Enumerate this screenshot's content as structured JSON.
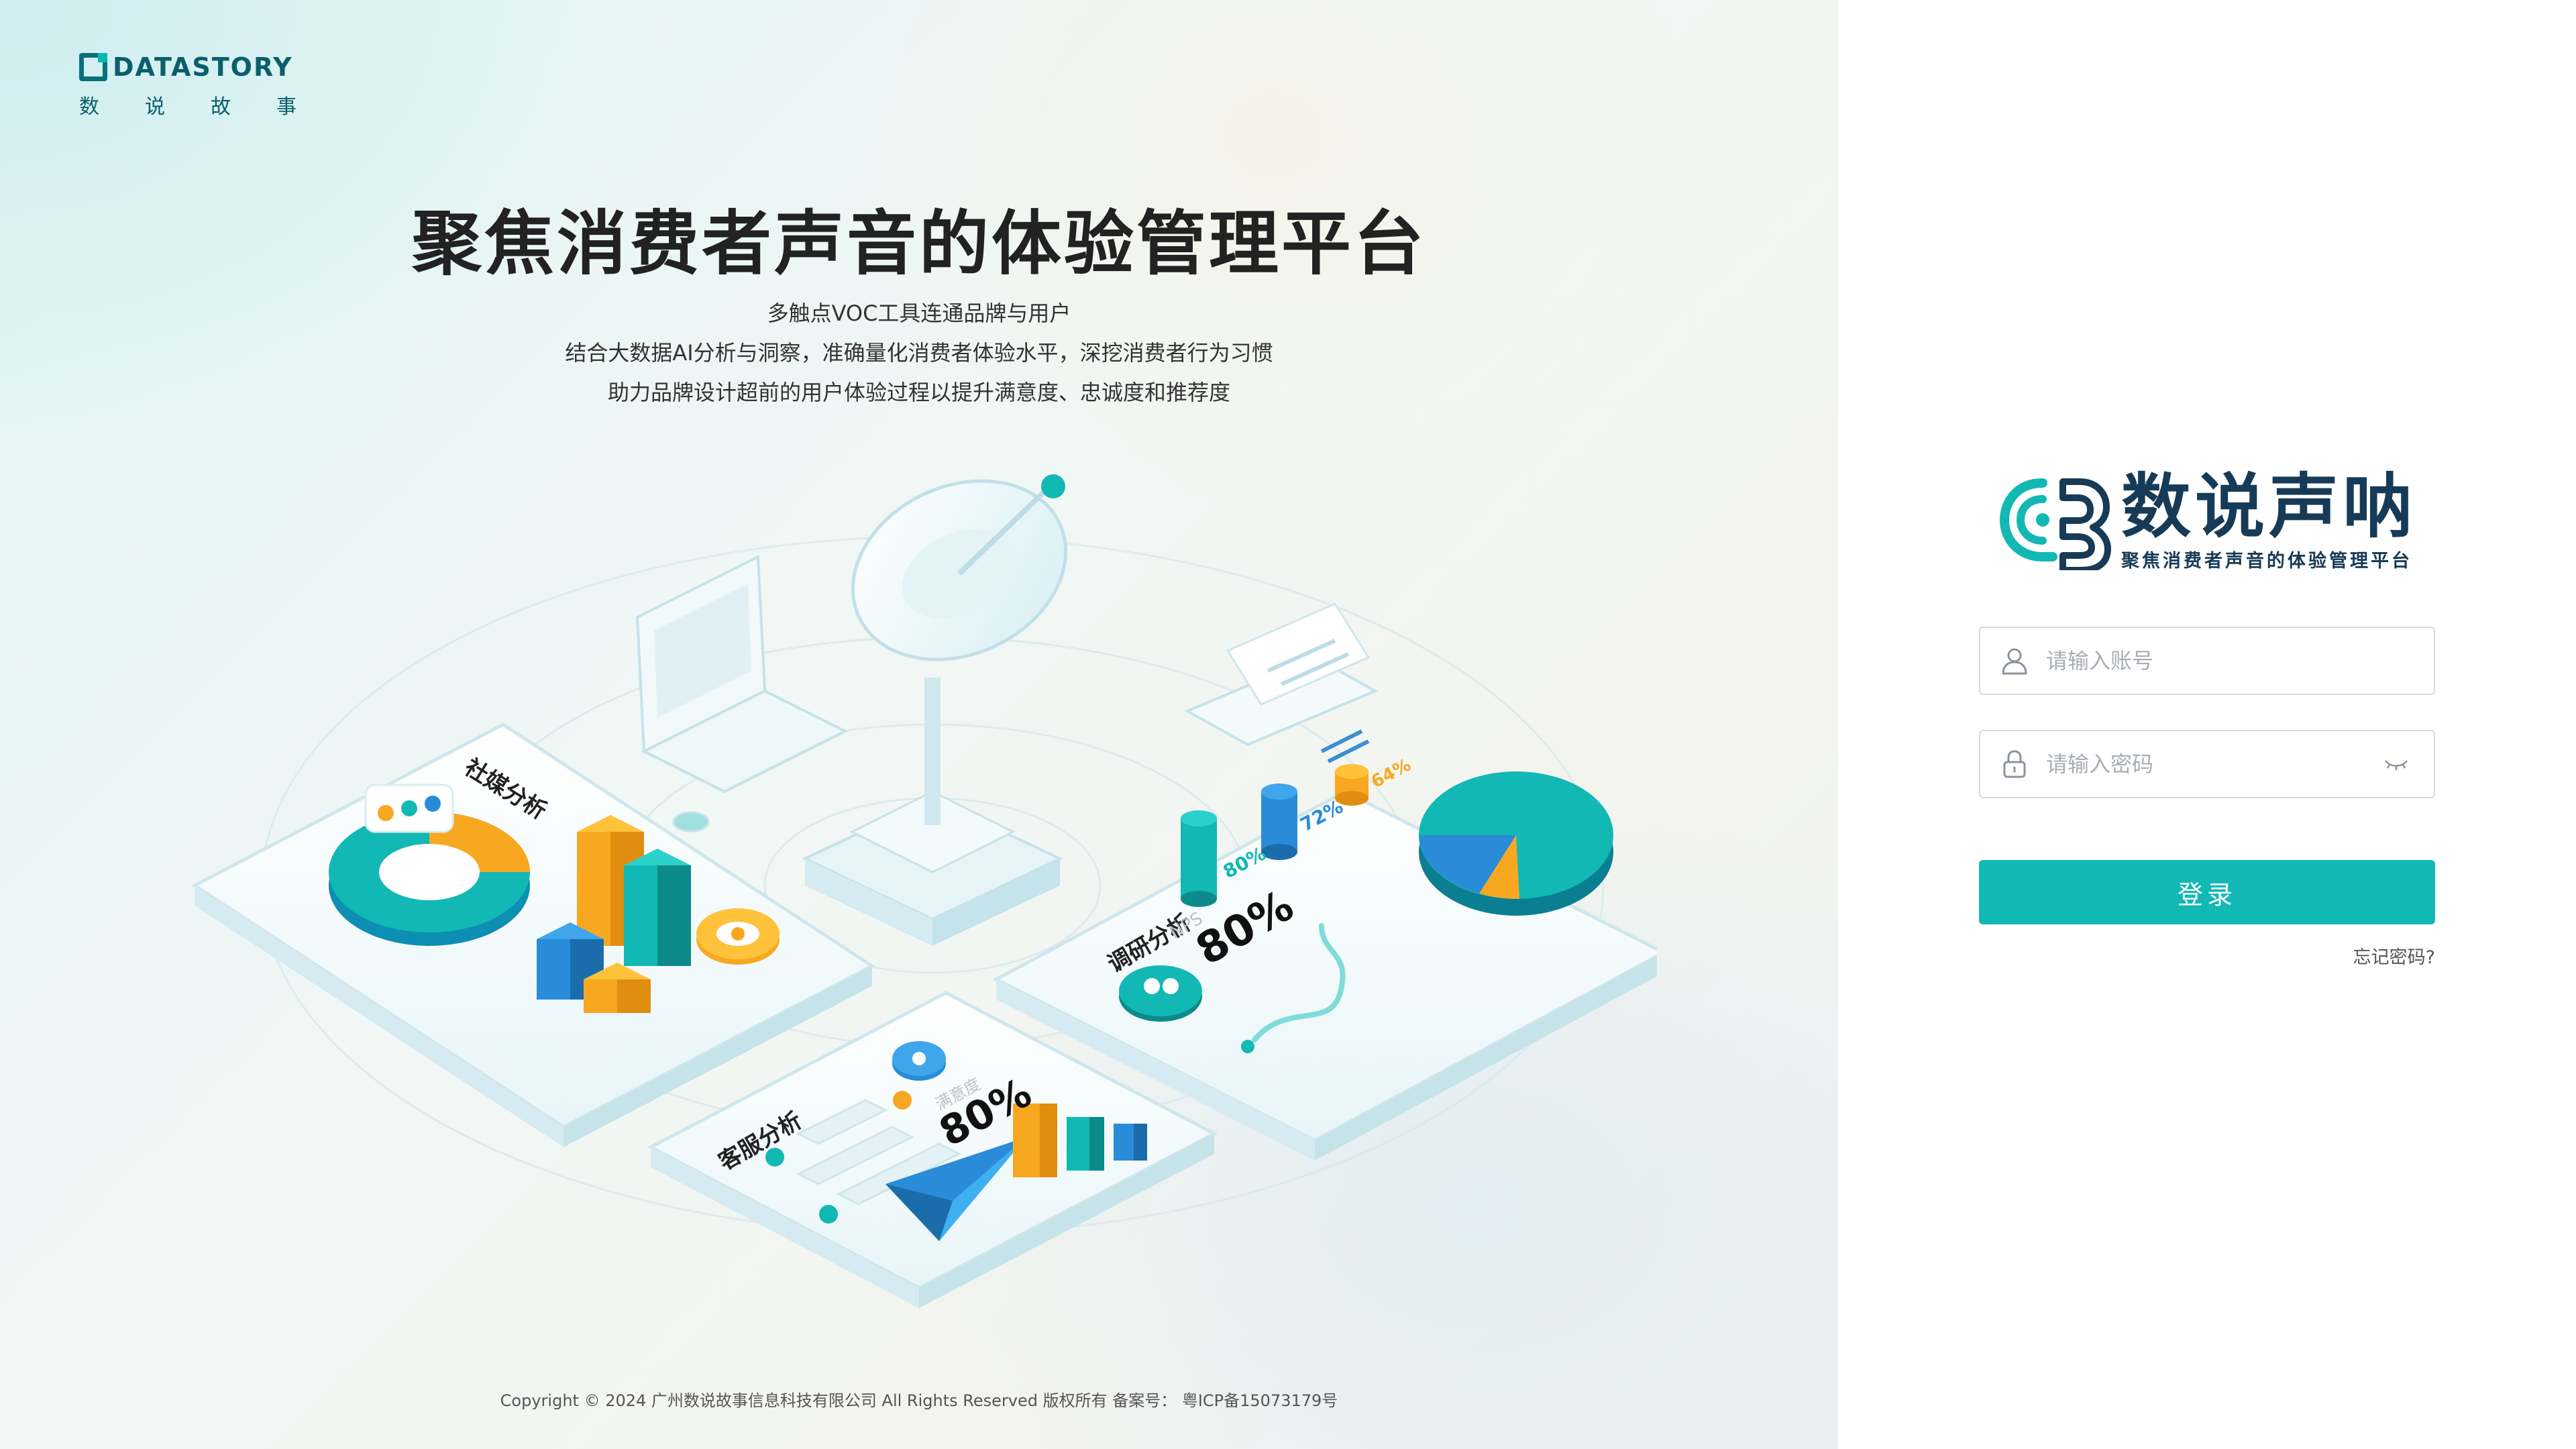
{
  "brand": {
    "name": "DATASTORY",
    "sub": [
      "数",
      "说",
      "故",
      "事"
    ]
  },
  "hero": {
    "title": "聚焦消费者声音的体验管理平台",
    "lines": [
      "多触点VOC工具连通品牌与用户",
      "结合大数据AI分析与洞察，准确量化消费者体验水平，深挖消费者行为习惯",
      "助力品牌设计超前的用户体验过程以提升满意度、忠诚度和推荐度"
    ]
  },
  "illustration": {
    "social_label": "社媒分析",
    "survey_label": "调研分析",
    "service_label": "客服分析",
    "nps_label": "NPS",
    "nps_value": "80%",
    "satisfaction_label": "满意度",
    "satisfaction_value": "80%",
    "pct_a": "80%",
    "pct_b": "72%",
    "pct_c": "64%"
  },
  "footer": {
    "copyright": "Copyright © 2024 广州数说故事信息科技有限公司 All Rights Reserved 版权所有 备案号： 粤ICP备15073179号"
  },
  "login": {
    "product_name": "数说声呐",
    "slogan": "聚焦消费者声音的体验管理平台",
    "account_placeholder": "请输入账号",
    "password_placeholder": "请输入密码",
    "login_label": "登录",
    "forgot_label": "忘记密码?"
  },
  "colors": {
    "accent": "#12b8b4",
    "brand_dark": "#0b5e6c",
    "logo_text": "#173b57"
  },
  "icons": {
    "account": "user-icon",
    "password": "lock-icon",
    "toggle": "eye-closed-icon"
  }
}
